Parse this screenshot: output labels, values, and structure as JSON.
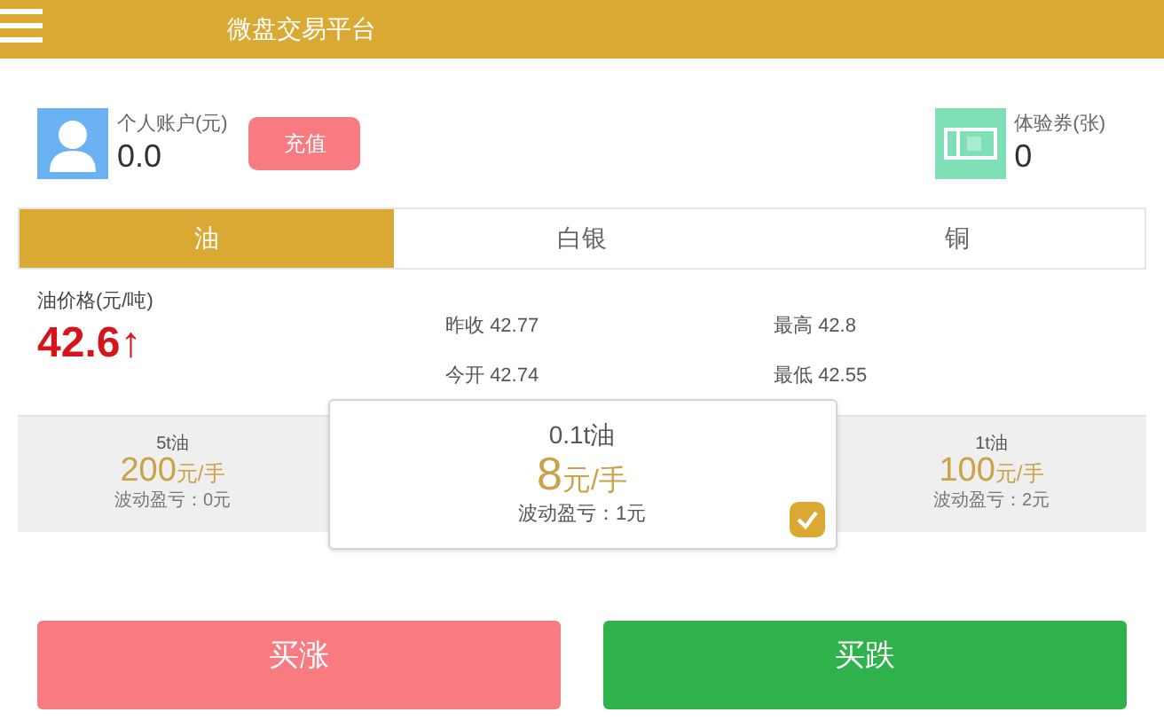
{
  "header": {
    "title": "微盘交易平台"
  },
  "account": {
    "label": "个人账户(元)",
    "value": "0.0",
    "recharge": "充值"
  },
  "voucher": {
    "label": "体验券(张)",
    "value": "0"
  },
  "tabs": [
    {
      "label": "油",
      "selected": true
    },
    {
      "label": "白银",
      "selected": false
    },
    {
      "label": "铜",
      "selected": false
    }
  ],
  "price": {
    "label": "油价格(元/吨)",
    "value": "42.6",
    "arrow": "↑"
  },
  "stats": [
    {
      "label": "昨收",
      "value": "42.77"
    },
    {
      "label": "最高",
      "value": "42.8"
    },
    {
      "label": "今开",
      "value": "42.74"
    },
    {
      "label": "最低",
      "value": "42.55"
    }
  ],
  "products": [
    {
      "name": "5t油",
      "amount": "200",
      "unit": "元/手",
      "fluctuation": "波动盈亏：0元",
      "selected": false
    },
    {
      "name": "0.1t油",
      "amount": "8",
      "unit": "元/手",
      "fluctuation": "波动盈亏：1元",
      "selected": true
    },
    {
      "name": "1t油",
      "amount": "100",
      "unit": "元/手",
      "fluctuation": "波动盈亏：2元",
      "selected": false
    }
  ],
  "actions": [
    {
      "label": "买涨",
      "kind": "up"
    },
    {
      "label": "买跌",
      "kind": "down"
    }
  ]
}
